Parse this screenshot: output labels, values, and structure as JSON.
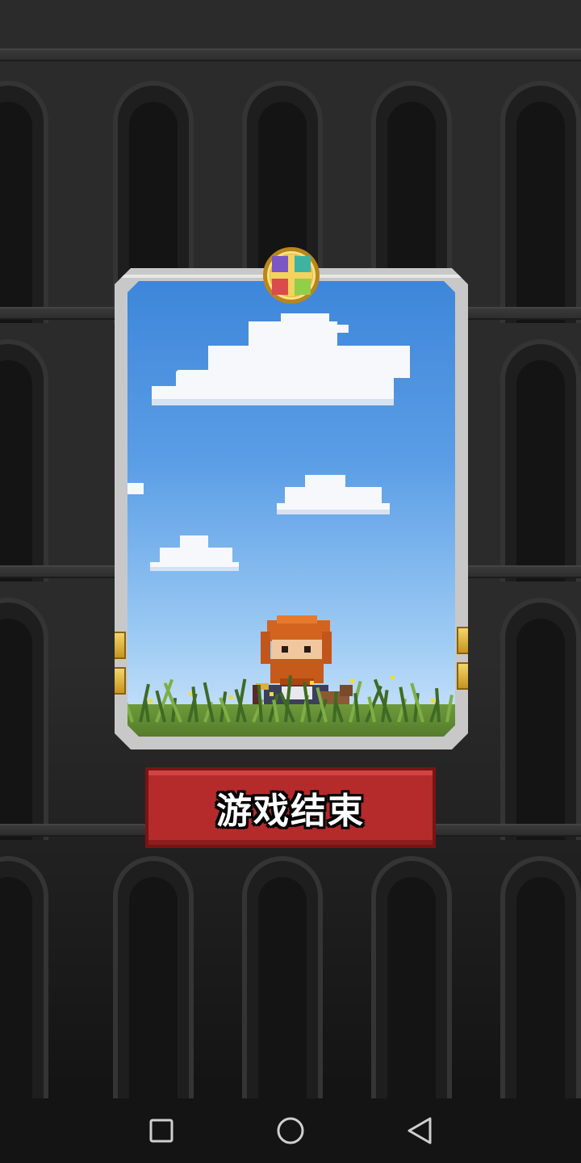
{
  "game_over_button": {
    "label": "游戏结束"
  },
  "card": {
    "frame_color": "#c8c8c8",
    "emblem": "compass-emblem-icon",
    "scene": "sky-with-clouds-and-grass",
    "character": "red-bearded-warrior"
  },
  "navbar": {
    "recent_apps_icon": "square-icon",
    "home_icon": "circle-icon",
    "back_icon": "triangle-back-icon"
  },
  "colors": {
    "button": "#b52b2b",
    "sky_top": "#3e86da",
    "sky_bottom": "#cfe6fb",
    "background": "#2b2b2b"
  }
}
